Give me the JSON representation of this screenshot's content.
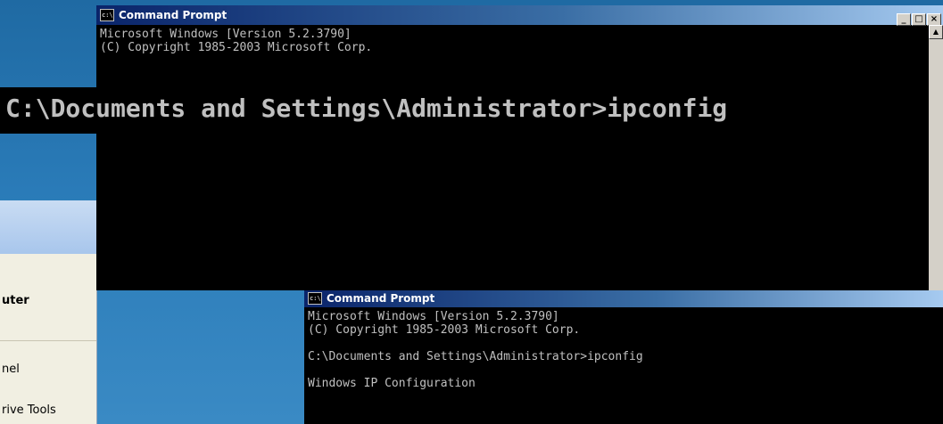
{
  "desktop": {
    "menu_items": [
      {
        "label": "uter",
        "bold": true
      },
      {
        "label": "nel",
        "bold": false
      },
      {
        "label": "rive Tools",
        "bold": false
      }
    ]
  },
  "window_back": {
    "title": "Command Prompt",
    "icon": "cmd-icon",
    "icon_text": "c:\\",
    "buttons": {
      "minimize": "_",
      "maximize": "□",
      "close": "×"
    },
    "lines": [
      "Microsoft Windows [Version 5.2.3790]",
      "(C) Copyright 1985-2003 Microsoft Corp."
    ]
  },
  "zoom": {
    "prompt_text": "C:\\Documents and Settings\\Administrator>ipconfig"
  },
  "window_front": {
    "title": "Command Prompt",
    "icon": "cmd-icon",
    "icon_text": "c:\\",
    "lines": [
      "Microsoft Windows [Version 5.2.3790]",
      "(C) Copyright 1985-2003 Microsoft Corp.",
      "",
      "C:\\Documents and Settings\\Administrator>ipconfig",
      "",
      "Windows IP Configuration"
    ]
  }
}
